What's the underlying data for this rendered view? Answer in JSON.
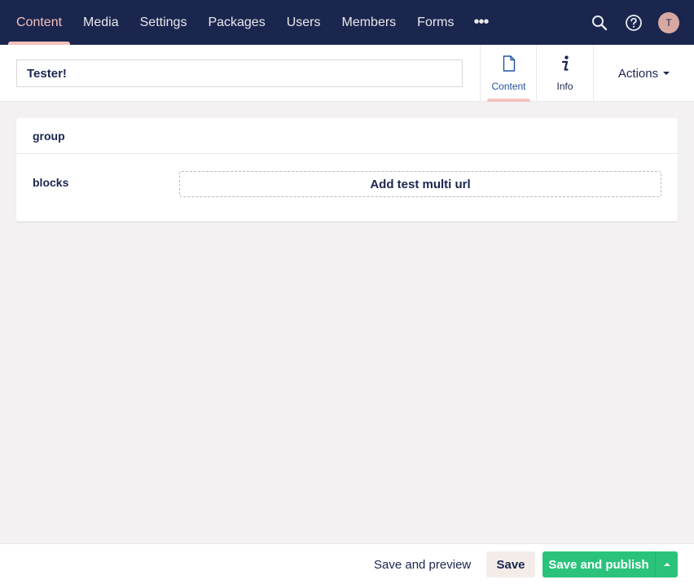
{
  "topnav": {
    "items": [
      {
        "label": "Content",
        "active": true
      },
      {
        "label": "Media"
      },
      {
        "label": "Settings"
      },
      {
        "label": "Packages"
      },
      {
        "label": "Users"
      },
      {
        "label": "Members"
      },
      {
        "label": "Forms"
      }
    ],
    "more_label": "•••",
    "avatar_initial": "T"
  },
  "editor": {
    "name_value": "Tester!",
    "tabs": [
      {
        "label": "Content",
        "icon": "document-icon",
        "active": true
      },
      {
        "label": "Info",
        "icon": "info-icon"
      }
    ],
    "actions_label": "Actions"
  },
  "panel": {
    "group_title": "group",
    "property_label": "blocks",
    "add_button_label": "Add test multi url"
  },
  "footer": {
    "preview_label": "Save and preview",
    "save_label": "Save",
    "publish_label": "Save and publish"
  },
  "colors": {
    "nav_bg": "#1b264f",
    "accent": "#f5c1bc",
    "publish": "#2bc37c",
    "page_bg": "#f3f1f1"
  }
}
